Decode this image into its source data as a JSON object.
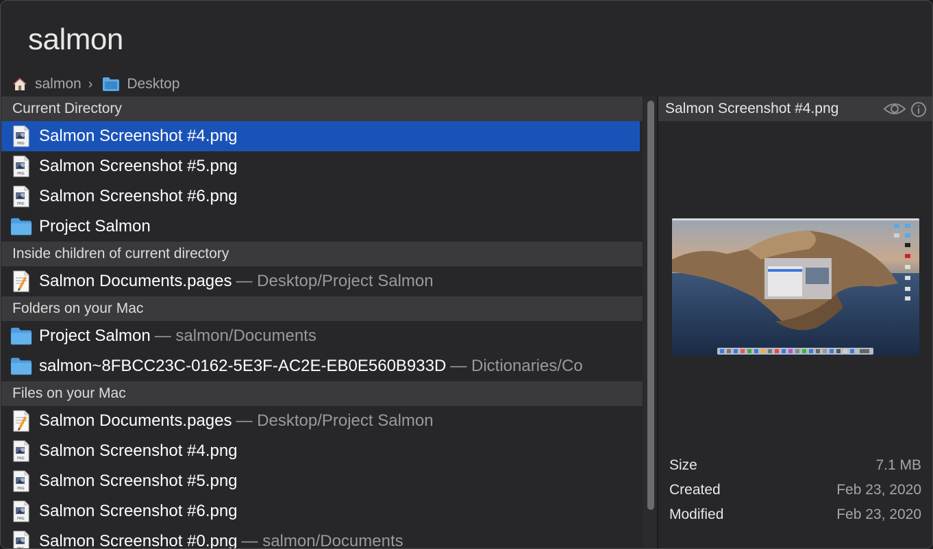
{
  "query": "salmon",
  "breadcrumb": {
    "home_label": "salmon",
    "separator": "›",
    "folder_label": "Desktop"
  },
  "sections": {
    "current_directory": "Current Directory",
    "inside_children": "Inside children of current directory",
    "folders_on_mac": "Folders on your Mac",
    "files_on_mac": "Files on your Mac"
  },
  "current_directory_items": [
    {
      "name": "Salmon Screenshot #4.png",
      "icon": "png-file-icon",
      "selected": true
    },
    {
      "name": "Salmon Screenshot #5.png",
      "icon": "png-file-icon"
    },
    {
      "name": "Salmon Screenshot #6.png",
      "icon": "png-file-icon"
    },
    {
      "name": "Project Salmon",
      "icon": "folder-icon"
    }
  ],
  "inside_children_items": [
    {
      "name": "Salmon Documents.pages",
      "path": "— Desktop/Project Salmon",
      "icon": "pages-document-icon"
    }
  ],
  "folders_items": [
    {
      "name": "Project Salmon",
      "path": "— salmon/Documents",
      "icon": "folder-icon"
    },
    {
      "name": "salmon~8FBCC23C-0162-5E3F-AC2E-EB0E560B933D",
      "path": "— Dictionaries/Co",
      "icon": "folder-icon"
    }
  ],
  "files_items": [
    {
      "name": "Salmon Documents.pages",
      "path": "— Desktop/Project Salmon",
      "icon": "pages-document-icon"
    },
    {
      "name": "Salmon Screenshot #4.png",
      "icon": "png-file-icon"
    },
    {
      "name": "Salmon Screenshot #5.png",
      "icon": "png-file-icon"
    },
    {
      "name": "Salmon Screenshot #6.png",
      "icon": "png-file-icon"
    },
    {
      "name": "Salmon Screenshot #0.png",
      "path": "— salmon/Documents",
      "icon": "png-file-icon"
    }
  ],
  "preview": {
    "title": "Salmon Screenshot #4.png",
    "size_label": "Size",
    "size_value": "7.1 MB",
    "created_label": "Created",
    "created_value": "Feb 23, 2020",
    "modified_label": "Modified",
    "modified_value": "Feb 23, 2020"
  },
  "colors": {
    "selection": "#1a53b8",
    "background": "#27272a",
    "section_header": "#3a3a3c",
    "folder": "#5aa9e6"
  }
}
